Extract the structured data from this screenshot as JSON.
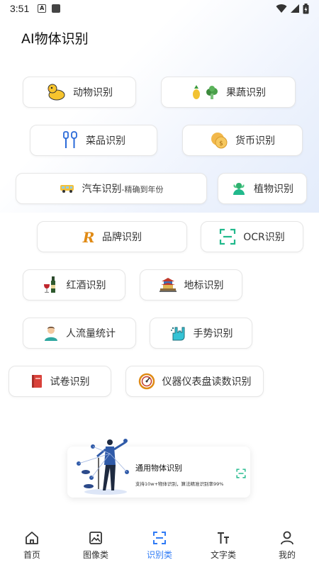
{
  "status": {
    "time": "3:51"
  },
  "app": {
    "title": "AI物体识别"
  },
  "chips": {
    "animal": "动物识别",
    "fruit": "果蔬识别",
    "dish": "菜品识别",
    "currency": "货币识别",
    "car_main": "汽车识别",
    "car_suffix": "-精确到年份",
    "plant": "植物识别",
    "brand": "品牌识别",
    "ocr": "OCR识别",
    "wine": "红酒识别",
    "landmark": "地标识别",
    "crowd": "人流量统计",
    "gesture": "手势识别",
    "exam": "试卷识别",
    "meter": "仪器仪表盘读数识别"
  },
  "banner": {
    "title": "通用物体识别",
    "subtitle": "支持10w+物体识别，算法精准识别率99%"
  },
  "tabs": [
    {
      "label": "首页",
      "icon": "home-icon"
    },
    {
      "label": "图像类",
      "icon": "image-icon"
    },
    {
      "label": "识别类",
      "icon": "scan-icon",
      "active": true
    },
    {
      "label": "文字类",
      "icon": "text-icon"
    },
    {
      "label": "我的",
      "icon": "user-icon"
    }
  ],
  "colors": {
    "accent": "#2f7bf5",
    "teal": "#21b98c"
  }
}
